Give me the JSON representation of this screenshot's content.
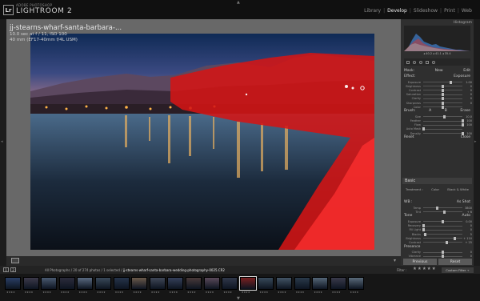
{
  "app": {
    "brand_sub": "ADOBE PHOTOSHOP",
    "brand_name": "LIGHTROOM 2",
    "logo_letters": "Lr"
  },
  "modules": [
    "Library",
    "Develop",
    "Slideshow",
    "Print",
    "Web"
  ],
  "active_module": "Develop",
  "photo_info": {
    "title": "jj-stearns-wharf-santa-barbara-...",
    "line1": "10.0 sec at f / 11, ISO 100",
    "line2": "40 mm (EF17-40mm f/4L USM)"
  },
  "histogram": {
    "header": "Histogram",
    "readout": "◂  40.2   ◂ 41.1   ◂ 35.4"
  },
  "brush_section": {
    "header_left": "Mask:",
    "header_mid": "New",
    "header_right": "Edit",
    "effect_label": "Effect:",
    "effect_value": "Exposure",
    "sliders": [
      {
        "label": "Exposure",
        "value": "1.00",
        "pos": 0.7
      },
      {
        "label": "Brightness",
        "value": "0",
        "pos": 0.5
      },
      {
        "label": "Contrast",
        "value": "0",
        "pos": 0.5
      },
      {
        "label": "Saturation",
        "value": "0",
        "pos": 0.5
      },
      {
        "label": "Clarity",
        "value": "0",
        "pos": 0.5
      },
      {
        "label": "Sharpness",
        "value": "0",
        "pos": 0.5
      },
      {
        "label": "Color",
        "value": "",
        "pos": 0.5
      }
    ],
    "brush_header": "Brush:",
    "brush_a": "A",
    "brush_b": "B",
    "brush_erase": "Erase",
    "brush_sliders": [
      {
        "label": "Size",
        "value": "10.0",
        "pos": 0.55
      },
      {
        "label": "Feather",
        "value": "100",
        "pos": 1.0
      },
      {
        "label": "Flow",
        "value": "100",
        "pos": 1.0
      },
      {
        "label": "Auto Mask",
        "value": "",
        "pos": 0.0
      },
      {
        "label": "Density",
        "value": "100",
        "pos": 1.0
      }
    ],
    "footer_left": "Reset",
    "footer_right": "Close"
  },
  "basic": {
    "header": "Basic",
    "treatment_label": "Treatment :",
    "treatment_color": "Color",
    "treatment_bw": "Black & White",
    "wb_label": "WB :",
    "wb_value": "As Shot",
    "wb_sliders": [
      {
        "label": "Temp",
        "value": "3800",
        "pos": 0.35
      },
      {
        "label": "Tint",
        "value": "+ 6",
        "pos": 0.55
      }
    ],
    "tone_label": "Tone",
    "tone_auto": "Auto",
    "tone_sliders": [
      {
        "label": "Exposure",
        "value": "0.00",
        "pos": 0.5
      },
      {
        "label": "Recovery",
        "value": "0",
        "pos": 0.0
      },
      {
        "label": "Fill Light",
        "value": "0",
        "pos": 0.0
      },
      {
        "label": "Blacks",
        "value": "5",
        "pos": 0.05
      },
      {
        "label": "Brightness",
        "value": "+ 110",
        "pos": 0.8
      },
      {
        "label": "Contrast",
        "value": "+ 25",
        "pos": 0.6
      }
    ],
    "presence_label": "Presence",
    "presence_sliders": [
      {
        "label": "Clarity",
        "value": "0",
        "pos": 0.5
      },
      {
        "label": "Vibrance",
        "value": "0",
        "pos": 0.5
      }
    ]
  },
  "buttons": {
    "previous": "Previous",
    "reset": "Reset"
  },
  "filmstrip_bar": {
    "btn1": "1",
    "btn2": "2",
    "source_prefix": "All Photographs / 20 of 274 photos / 1 selected /",
    "source_file": "jj-stearns-wharf-santa-barbara-wedding-photography-0025.CR2",
    "filter_label": "Filter :",
    "stars": "★★★★★",
    "custom_filter": "Custom Filter ÷"
  },
  "filmstrip": {
    "count": 20,
    "selected_index": 13,
    "thumb_label": "★★★★"
  },
  "colors": {
    "accent_red": "#d41414",
    "panel_bg": "#2f2f2f",
    "center_bg": "#686868"
  }
}
